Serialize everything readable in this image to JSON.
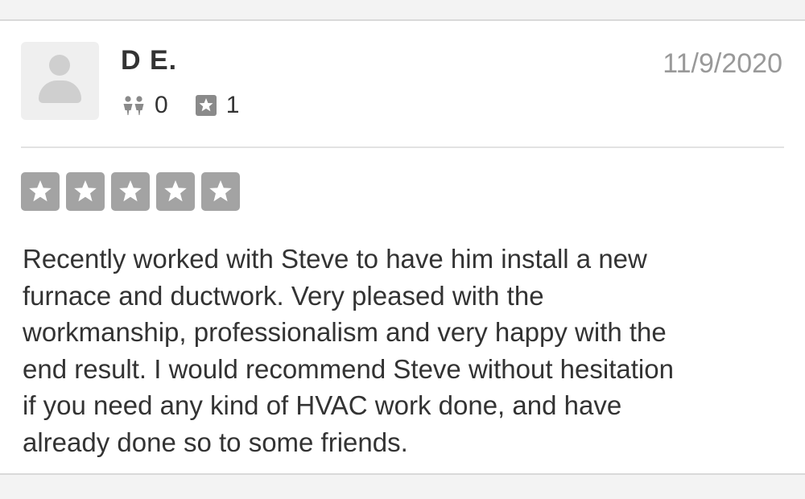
{
  "review": {
    "user_name": "D E.",
    "date": "11/9/2020",
    "friends_count": "0",
    "reviews_count": "1",
    "rating": 5,
    "rating_max": 5,
    "text": "Recently worked with Steve to have him install a new\nfurnace and ductwork.  Very pleased with the\nworkmanship, professionalism and very happy with the\nend result.  I would recommend Steve without hesitation\nif you need any kind of HVAC work done, and have\nalready done so to some friends."
  },
  "icons": {
    "avatar": "user-silhouette-icon",
    "friends": "friends-icon",
    "reviews": "star-badge-icon",
    "rating_star": "star-icon"
  },
  "colors": {
    "star_box": "#a3a3a3",
    "text": "#333333",
    "date": "#999999"
  }
}
